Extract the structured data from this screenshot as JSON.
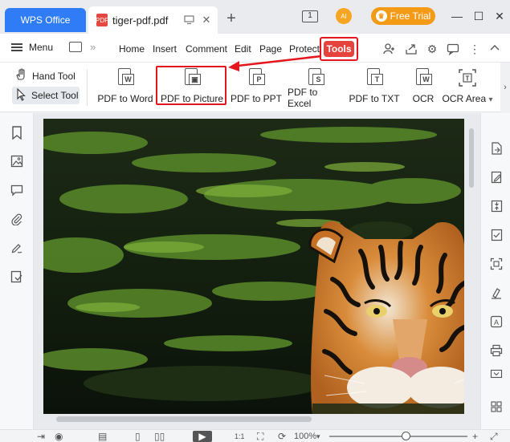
{
  "tabs": {
    "app_tab": "WPS Office",
    "doc_tab": "tiger-pdf.pdf",
    "pdf_badge": "PDF",
    "new_tab_symbol": "+"
  },
  "titlebar": {
    "window_count": "1",
    "avatar_text": "AI",
    "free_trial": "Free Trial",
    "minimize": "—",
    "maximize": "☐",
    "close": "✕"
  },
  "menubar": {
    "menu_label": "Menu",
    "items": [
      "Home",
      "Insert",
      "Comment",
      "Edit",
      "Page",
      "Protect"
    ],
    "tools": "Tools"
  },
  "ribbon": {
    "hand_tool": "Hand Tool",
    "select_tool": "Select Tool",
    "buttons": [
      {
        "label": "PDF to Word",
        "badge": "W"
      },
      {
        "label": "PDF to Picture",
        "badge": "▣"
      },
      {
        "label": "PDF to PPT",
        "badge": "P"
      },
      {
        "label": "PDF to Excel",
        "badge": "S"
      },
      {
        "label": "PDF to TXT",
        "badge": "T"
      },
      {
        "label": "OCR",
        "badge": "W"
      },
      {
        "label": "OCR Area",
        "badge": "T"
      }
    ],
    "ocr_area_dropdown": "▾",
    "scroll_right": "›"
  },
  "statusbar": {
    "zoom": "100%",
    "page_fit": "1:1"
  },
  "colors": {
    "accent_blue": "#2f7cf6",
    "tools_red": "#e5433b",
    "highlight_red": "#e4161c",
    "trial_orange": "#f39a17"
  }
}
